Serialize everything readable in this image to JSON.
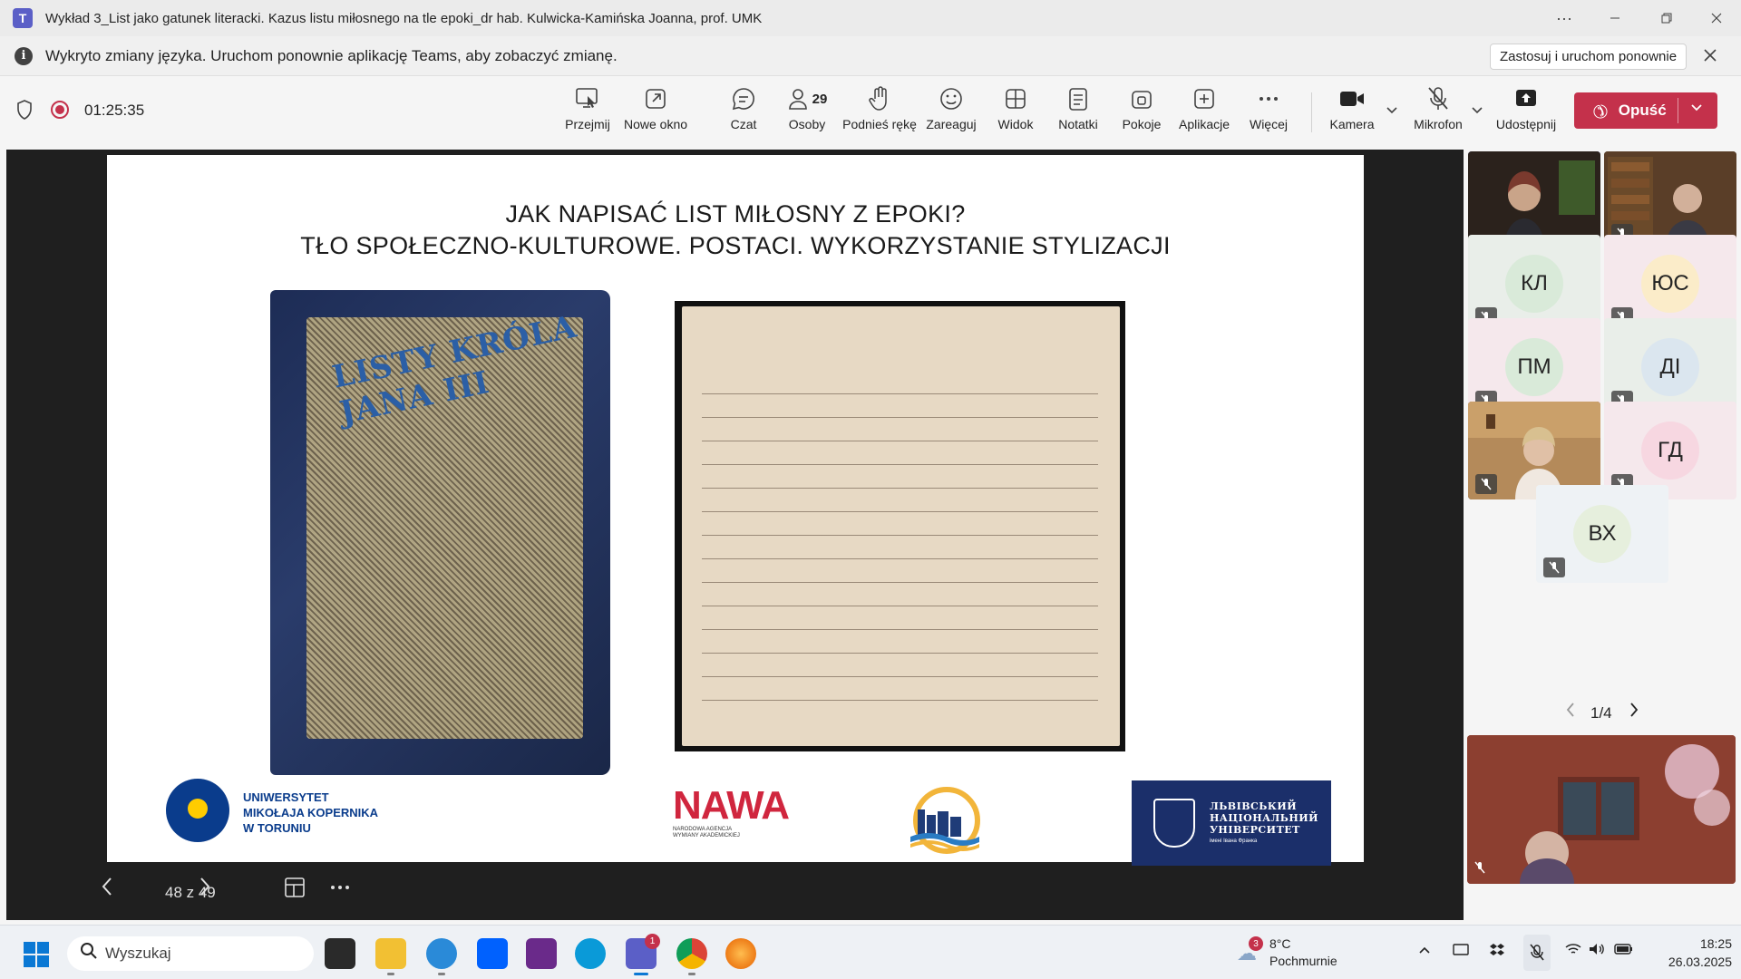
{
  "window": {
    "title": "Wykład 3_List jako gatunek literacki. Kazus listu miłosnego na tle epoki_dr hab. Kulwicka-Kamińska Joanna, prof. UMK",
    "app_icon": "teams-icon",
    "more_label": "···"
  },
  "notification": {
    "message": "Wykryto zmiany języka. Uruchom ponownie aplikację Teams, aby zobaczyć zmianę.",
    "apply_button": "Zastosuj i uruchom ponownie"
  },
  "meeting": {
    "timer": "01:25:35",
    "people_count": "29",
    "toolbar": [
      {
        "label": "Przejmij",
        "icon": "take-control-icon"
      },
      {
        "label": "Nowe okno",
        "icon": "pop-out-icon"
      },
      {
        "label": "Czat",
        "icon": "chat-icon"
      },
      {
        "label": "Osoby",
        "icon": "people-icon"
      },
      {
        "label": "Podnieś rękę",
        "icon": "raise-hand-icon"
      },
      {
        "label": "Zareaguj",
        "icon": "react-icon"
      },
      {
        "label": "Widok",
        "icon": "view-icon"
      },
      {
        "label": "Notatki",
        "icon": "notes-icon"
      },
      {
        "label": "Pokoje",
        "icon": "rooms-icon"
      },
      {
        "label": "Aplikacje",
        "icon": "apps-icon"
      },
      {
        "label": "Więcej",
        "icon": "more-icon"
      },
      {
        "label": "Kamera",
        "icon": "camera-icon"
      },
      {
        "label": "Mikrofon",
        "icon": "mic-off-icon"
      },
      {
        "label": "Udostępnij",
        "icon": "share-icon"
      }
    ],
    "leave_label": "Opuść",
    "accent": "#c4314b"
  },
  "slide": {
    "title_line1": "JAK NAPISAĆ LIST MIŁOSNY Z EPOKI?",
    "title_line2": "TŁO SPOŁECZNO-KULTUROWE. POSTACI. WYKORZYSTANIE STYLIZACJI",
    "book_caption": "LISTY KRÓLA JANA III",
    "logo_umk": "UNIWERSYTET\nMIKOŁAJA KOPERNIKA\nW TORUNIU",
    "logo_nawa": "NAWA",
    "logo_nawa_sub": "NARODOWA AGENCJA\nWYMIANY AKADEMICKIEJ",
    "logo_lnu": "ЛЬВІВСЬКИЙ\nНАЦІОНАЛЬНИЙ\nУНІВЕРСИТЕТ",
    "logo_lnu_sub": "імені Івана Франка",
    "page_counter": "48 z 49"
  },
  "participants": {
    "tiles": [
      {
        "initials": "",
        "type": "video",
        "muted": false
      },
      {
        "initials": "",
        "type": "video",
        "muted": true
      },
      {
        "initials": "КЛ",
        "type": "avatar",
        "muted": true,
        "avatar_color": "#d9ead9"
      },
      {
        "initials": "ЮС",
        "type": "avatar",
        "muted": true,
        "avatar_color": "#fbecc9"
      },
      {
        "initials": "ПМ",
        "type": "avatar",
        "muted": true,
        "avatar_color": "#d9ead9"
      },
      {
        "initials": "ДІ",
        "type": "avatar",
        "muted": true,
        "avatar_color": "#dbe6ef"
      },
      {
        "initials": "",
        "type": "video",
        "muted": true
      },
      {
        "initials": "ГД",
        "type": "avatar",
        "muted": true,
        "avatar_color": "#f7d7e1"
      },
      {
        "initials": "ВХ",
        "type": "avatar",
        "muted": true,
        "avatar_color": "#e6efdd"
      }
    ],
    "page_indicator": "1/4"
  },
  "taskbar": {
    "search_placeholder": "Wyszukaj",
    "teams_badge": "1",
    "weather_badge": "3",
    "temperature": "8°C",
    "condition": "Pochmurnie",
    "time": "18:25",
    "date": "26.03.2025"
  }
}
